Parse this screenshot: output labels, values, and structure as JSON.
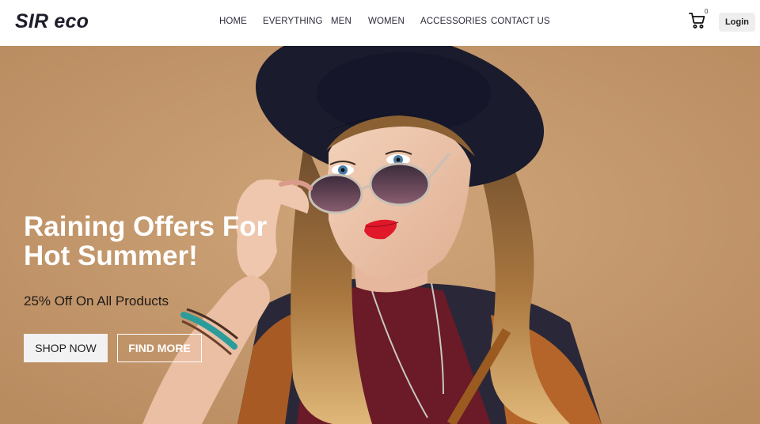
{
  "brand": {
    "logo": "SIR eco"
  },
  "nav": {
    "items": [
      "HOME",
      "EVERYTHING",
      "MEN",
      "WOMEN",
      "ACCESSORIES",
      "CONTACT US"
    ]
  },
  "cart": {
    "count": "0",
    "icon": "cart-icon"
  },
  "header": {
    "login_label": "Login"
  },
  "hero": {
    "title_line1": "Raining Offers For",
    "title_line2": "Hot Summer!",
    "subtitle": "25% Off On All Products",
    "shop_label": "SHOP NOW",
    "find_label": "FIND MORE",
    "background_color": "#c59a6f",
    "image": "woman-in-hat-and-sunglasses"
  },
  "colors": {
    "accent_text": "#ffffff",
    "dark_text": "#1d1d2b"
  }
}
